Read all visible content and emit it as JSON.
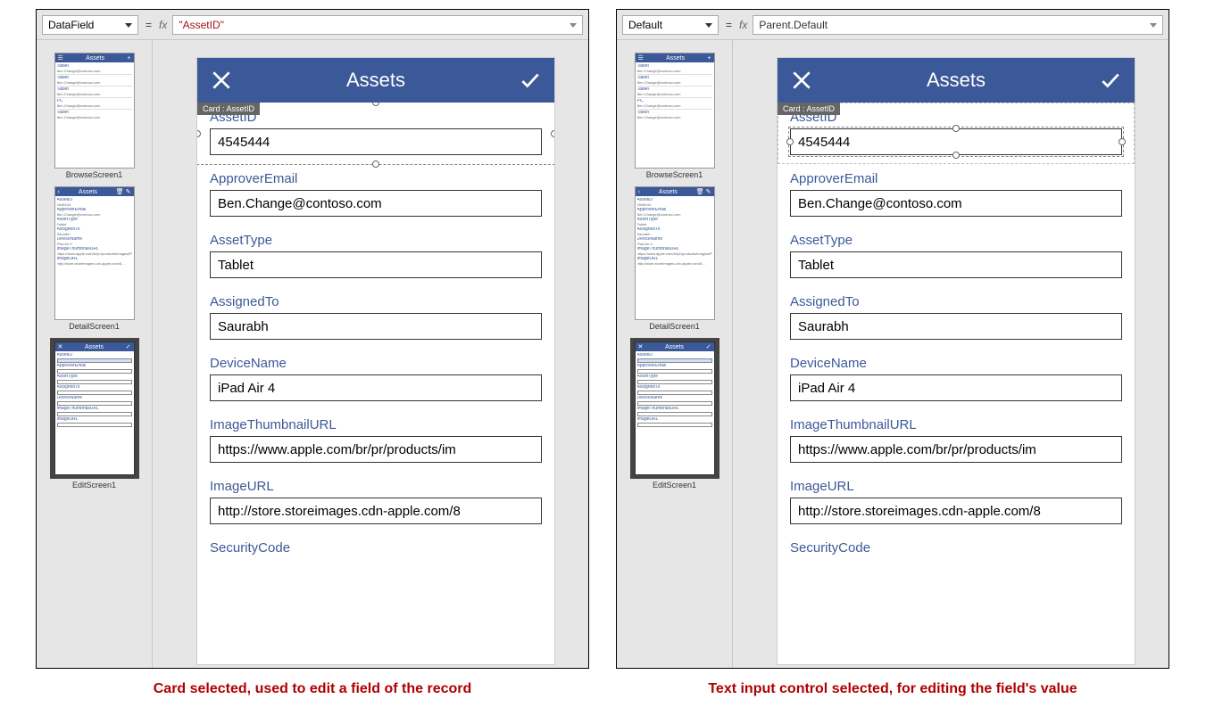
{
  "left": {
    "property_name": "DataField",
    "formula": "\"AssetID\"",
    "selected_card_tag": "Card : AssetID",
    "caption": "Card selected, used to edit a field of the record",
    "selection_mode": "card"
  },
  "right": {
    "property_name": "Default",
    "formula": "Parent.Default",
    "selected_card_tag": "Card : AssetID",
    "caption": "Text input control selected, for editing the field's value",
    "selection_mode": "input"
  },
  "screen_thumbs": [
    {
      "name": "BrowseScreen1"
    },
    {
      "name": "DetailScreen1"
    },
    {
      "name": "EditScreen1"
    }
  ],
  "phone": {
    "title": "Assets",
    "fields": [
      {
        "label": "AssetID",
        "value": "4545444"
      },
      {
        "label": "ApproverEmail",
        "value": "Ben.Change@contoso.com"
      },
      {
        "label": "AssetType",
        "value": "Tablet"
      },
      {
        "label": "AssignedTo",
        "value": "Saurabh"
      },
      {
        "label": "DeviceName",
        "value": "iPad Air 4"
      },
      {
        "label": "ImageThumbnailURL",
        "value": "https://www.apple.com/br/pr/products/im"
      },
      {
        "label": "ImageURL",
        "value": "http://store.storeimages.cdn-apple.com/8"
      },
      {
        "label": "SecurityCode",
        "value": ""
      }
    ]
  },
  "browse_thumb_items": [
    "Tablet",
    "Tablet",
    "Tablet",
    "PC",
    "Tablet"
  ]
}
